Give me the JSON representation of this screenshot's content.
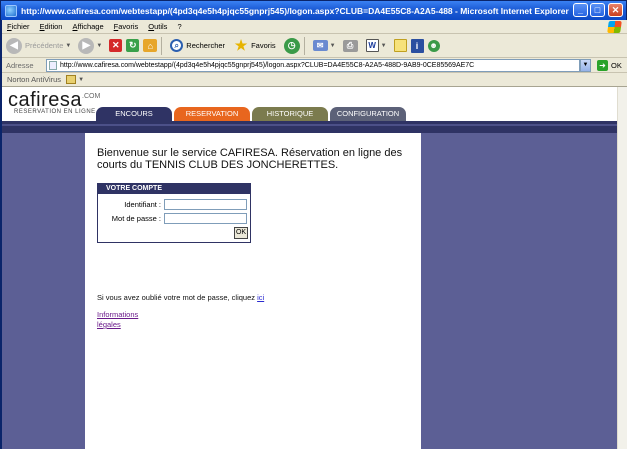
{
  "window": {
    "title": "http://www.cafiresa.com/webtestapp/(4pd3q4e5h4pjqc55gnprj545)/logon.aspx?CLUB=DA4E55C8-A2A5-488 - Microsoft Internet Explorer",
    "min_glyph": "_",
    "max_glyph": "□",
    "close_glyph": "✕"
  },
  "menu": [
    "Fichier",
    "Edition",
    "Affichage",
    "Favoris",
    "Outils",
    "?"
  ],
  "toolbar": {
    "back_label": "Précédente",
    "search_label": "Rechercher",
    "favorites_label": "Favoris"
  },
  "address": {
    "label": "Adresse",
    "url": "http://www.cafiresa.com/webtestapp/(4pd3q4e5h4pjqc55gnprj545)/logon.aspx?CLUB=DA4E55C8-A2A5-488D-9AB9-0CE85569AE7C",
    "go_label": "OK"
  },
  "links_bar": {
    "norton_label": "Norton AntiVirus"
  },
  "site": {
    "logo_name": "cafiresa",
    "logo_com": ".COM",
    "logo_tagline": "RESERVATION EN LIGNE",
    "tabs": [
      "ENCOURS",
      "RESERVATION",
      "HISTORIQUE",
      "CONFIGURATION"
    ],
    "colors": {
      "navy": "#2f3364",
      "reservation_orange": "#e8661e",
      "historique_olive": "#7b7b4e",
      "side_purple": "#5c5f95"
    }
  },
  "content": {
    "welcome": "Bienvenue sur le service CAFIRESA. Réservation en ligne des courts du TENNIS CLUB DES JONCHERETTES.",
    "account_title": "VOTRE COMPTE",
    "identifiant_label": "Identifiant :",
    "password_label": "Mot de passe :",
    "ok_label": "OK",
    "forgot_text": "Si vous avez oublié votre mot de passe, cliquez ",
    "forgot_link": "ici",
    "info_link": "Informations légales"
  }
}
